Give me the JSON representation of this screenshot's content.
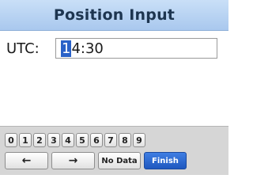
{
  "title": "Position Input",
  "field": {
    "label": "UTC:",
    "value_first_char": "1",
    "value_rest": "4:30"
  },
  "keypad": {
    "digits": [
      "0",
      "1",
      "2",
      "3",
      "4",
      "5",
      "6",
      "7",
      "8",
      "9"
    ],
    "left_arrow": "←",
    "right_arrow": "→",
    "no_data": "No Data",
    "finish": "Finish"
  }
}
